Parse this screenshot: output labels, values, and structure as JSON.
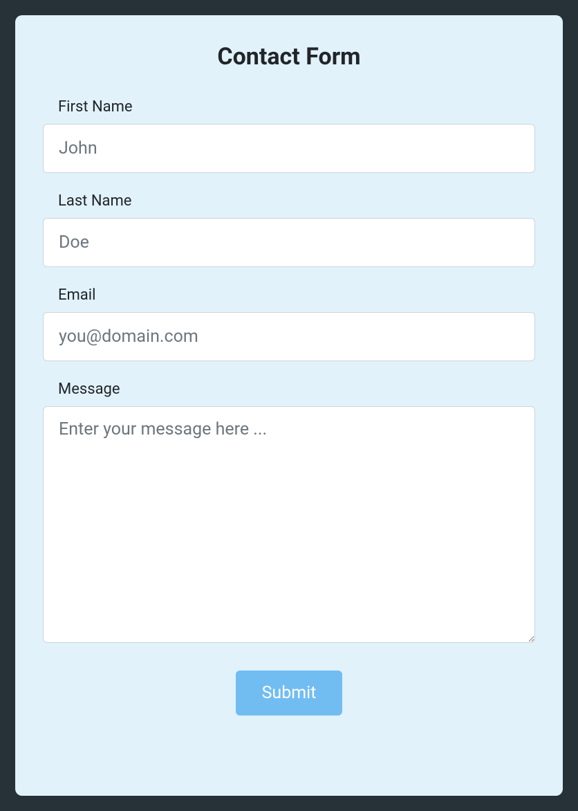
{
  "form": {
    "title": "Contact Form",
    "fields": {
      "firstName": {
        "label": "First Name",
        "placeholder": "John",
        "value": ""
      },
      "lastName": {
        "label": "Last Name",
        "placeholder": "Doe",
        "value": ""
      },
      "email": {
        "label": "Email",
        "placeholder": "you@domain.com",
        "value": ""
      },
      "message": {
        "label": "Message",
        "placeholder": "Enter your message here ...",
        "value": ""
      }
    },
    "submit_label": "Submit"
  }
}
